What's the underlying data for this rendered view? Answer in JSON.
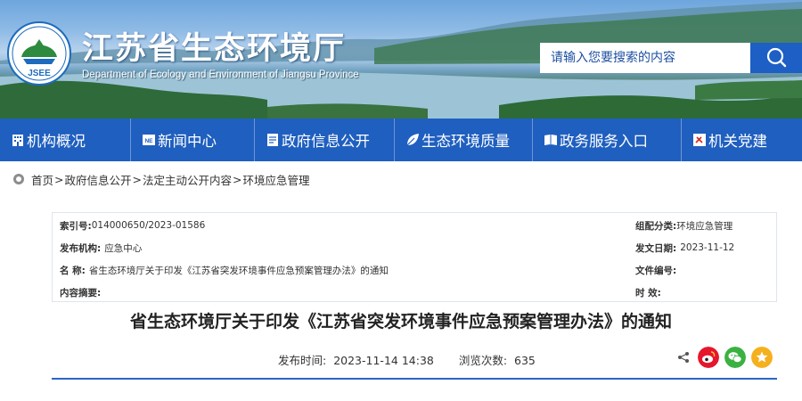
{
  "header": {
    "title_cn": "江苏省生态环境厅",
    "title_en": "Department of Ecology and Environment of Jiangsu Province",
    "logo_text": "JSEE",
    "search": {
      "placeholder": "请输入您要搜索的内容",
      "icon": "search-icon"
    }
  },
  "nav": {
    "items": [
      {
        "label": "机构概况",
        "icon": "building-icon"
      },
      {
        "label": "新闻中心",
        "icon": "news-icon"
      },
      {
        "label": "政府信息公开",
        "icon": "document-icon"
      },
      {
        "label": "生态环境质量",
        "icon": "leaf-icon"
      },
      {
        "label": "政务服务入口",
        "icon": "book-icon"
      },
      {
        "label": "机关党建",
        "icon": "party-emblem-icon"
      }
    ]
  },
  "breadcrumb": {
    "items": [
      "首页",
      "政府信息公开",
      "法定主动公开内容",
      "环境应急管理"
    ],
    "separator": ">"
  },
  "info": {
    "index_label": "索引号:",
    "index_value": "014000650/2023-01586",
    "category_label": "组配分类:",
    "category_value": "环境应急管理",
    "issuer_label": "发布机构:",
    "issuer_value": "应急中心",
    "date_label": "发文日期:",
    "date_value": "2023-11-12",
    "name_label": "名 称:",
    "name_value": "省生态环境厅关于印发《江苏省突发环境事件应急预案管理办法》的通知",
    "docno_label": "文件编号:",
    "docno_value": "",
    "summary_label": "内容摘要:",
    "summary_value": "",
    "validity_label": "时 效:",
    "validity_value": ""
  },
  "article": {
    "title": "省生态环境厅关于印发《江苏省突发环境事件应急预案管理办法》的通知",
    "publish_label": "发布时间:",
    "publish_value": "2023-11-14 14:38",
    "views_label": "浏览次数:",
    "views_value": "635"
  },
  "share": {
    "icons": [
      "share-icon",
      "weibo-icon",
      "wechat-icon",
      "favorite-star-icon"
    ],
    "colors": {
      "weibo": "#e6162d",
      "wechat": "#3bb142",
      "favorite": "#f5b01e"
    }
  },
  "colors": {
    "nav": "#1f5fbf",
    "accent": "#2b66c6"
  }
}
